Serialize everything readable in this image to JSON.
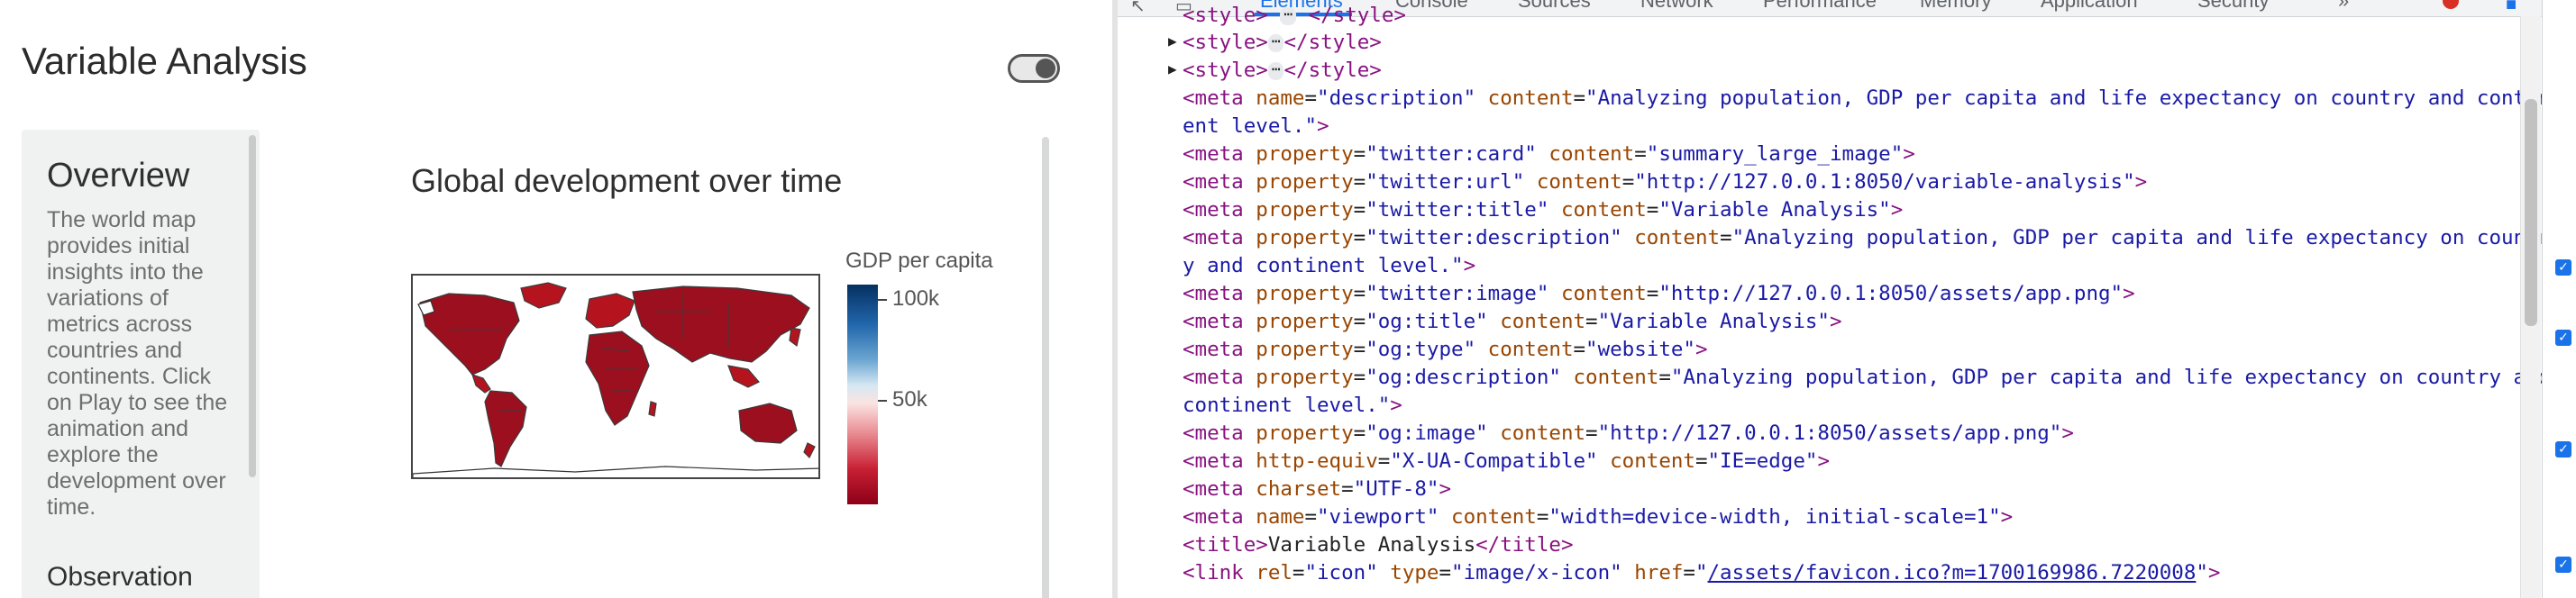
{
  "app": {
    "title": "Variable Analysis",
    "sidebar": {
      "heading": "Overview",
      "text": "The world map provides initial insights into the variations of metrics across countries and continents. Click on Play to see the animation and explore the development over time.",
      "next_heading": "Observation"
    },
    "chart": {
      "title": "Global development over time",
      "legend_title": "GDP per capita",
      "legend_ticks": [
        "100k",
        "50k"
      ]
    }
  },
  "devtools": {
    "tabs": [
      "Elements",
      "Console",
      "Sources",
      "Network",
      "Performance",
      "Memory",
      "Application",
      "Security",
      "»"
    ],
    "active_tab": "Elements",
    "style_tag": "style",
    "ellipsis": "⋯",
    "lines": {
      "desc_attr_name": "description",
      "desc_content_1": "\"Analyzing population, GDP per capita and life expectancy on country and contin",
      "desc_content_2": "ent level.\"",
      "twitter_card_prop": "\"twitter:card\"",
      "twitter_card_val": "\"summary_large_image\"",
      "twitter_url_prop": "\"twitter:url\"",
      "twitter_url_val": "\"http://127.0.0.1:8050/variable-analysis\"",
      "twitter_title_prop": "\"twitter:title\"",
      "twitter_title_val": "\"Variable Analysis\"",
      "twitter_desc_prop": "\"twitter:description\"",
      "twitter_desc_val_1": "\"Analyzing population, GDP per capita and life expectancy on countr",
      "twitter_desc_val_2": "y and continent level.\"",
      "twitter_image_prop": "\"twitter:image\"",
      "twitter_image_val": "\"http://127.0.0.1:8050/assets/app.png\"",
      "og_title_prop": "\"og:title\"",
      "og_title_val": "\"Variable Analysis\"",
      "og_type_prop": "\"og:type\"",
      "og_type_val": "\"website\"",
      "og_desc_prop": "\"og:description\"",
      "og_desc_val_1": "\"Analyzing population, GDP per capita and life expectancy on country and",
      "og_desc_val_2": "continent level.\"",
      "og_image_prop": "\"og:image\"",
      "og_image_val": "\"http://127.0.0.1:8050/assets/app.png\"",
      "http_equiv_val": "\"X-UA-Compatible\"",
      "http_equiv_content": "\"IE=edge\"",
      "charset_val": "\"UTF-8\"",
      "viewport_name": "\"viewport\"",
      "viewport_content": "\"width=device-width, initial-scale=1\"",
      "title_text": "Variable Analysis",
      "link_rel": "\"icon\"",
      "link_type": "\"image/x-icon\"",
      "link_href": "/assets/favicon.ico?m=1700169986.7220008"
    }
  },
  "colors": {
    "tag": "#881280",
    "attribute": "#994500",
    "value": "#1a1aa6",
    "accent": "#1a73e8"
  }
}
